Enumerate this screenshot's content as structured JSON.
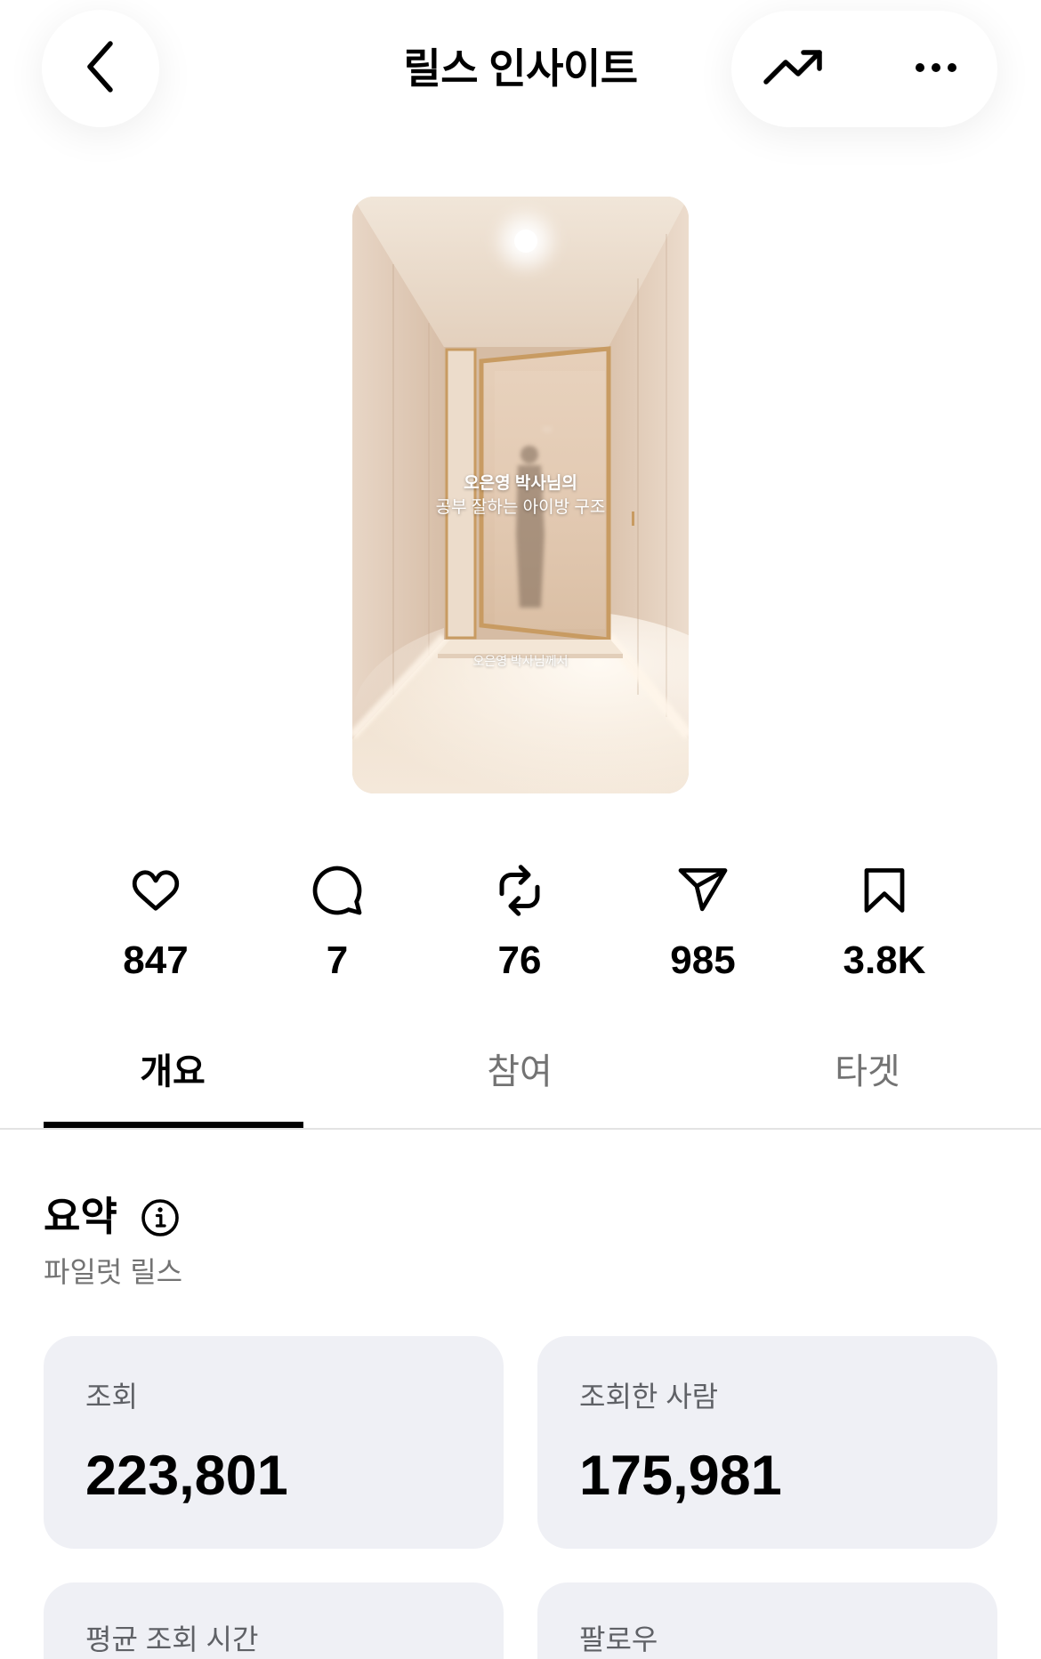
{
  "header": {
    "title": "릴스 인사이트",
    "back_icon": "chevron-left-icon",
    "trend_icon": "trending-up-icon",
    "more_icon": "more-horizontal-icon"
  },
  "reel": {
    "caption_title": "오은영 박사님의",
    "caption_subtitle": "공부 잘하는 아이방 구조",
    "caption_footer": "오은영 박사님께서"
  },
  "stats": [
    {
      "icon": "heart-icon",
      "value": "847"
    },
    {
      "icon": "comment-icon",
      "value": "7"
    },
    {
      "icon": "repost-icon",
      "value": "76"
    },
    {
      "icon": "share-icon",
      "value": "985"
    },
    {
      "icon": "bookmark-icon",
      "value": "3.8K"
    }
  ],
  "tabs": [
    {
      "label": "개요",
      "active": true
    },
    {
      "label": "참여",
      "active": false
    },
    {
      "label": "타겟",
      "active": false
    }
  ],
  "summary": {
    "title": "요약",
    "info_icon": "info-icon",
    "subtitle": "파일럿 릴스",
    "metrics": [
      {
        "label": "조회",
        "value": "223,801"
      },
      {
        "label": "조회한 사람",
        "value": "175,981"
      },
      {
        "label": "평균 조회 시간"
      },
      {
        "label": "팔로우"
      }
    ]
  },
  "colors": {
    "text": "#000000",
    "muted": "#737373",
    "card_background": "#eff0f5",
    "divider": "#e3e3e3",
    "door_frame": "#c89b62"
  }
}
